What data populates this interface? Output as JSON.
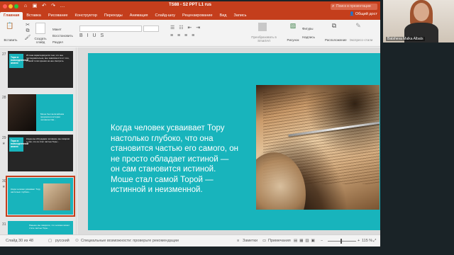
{
  "window": {
    "title": "TS88 - S2 PPT L1 rus",
    "search_placeholder": "Поиск в презентации",
    "share_label": "Общий дост"
  },
  "ribbon_tabs": [
    "Главная",
    "Вставка",
    "Рисование",
    "Конструктор",
    "Переходы",
    "Анимация",
    "Слайд-шоу",
    "Рецензирование",
    "Вид",
    "Запись"
  ],
  "ribbon": {
    "paste": "Вставить",
    "new_slide": "Создать слайд",
    "layout": "Макет",
    "reset": "Восстановить",
    "section": "Раздел",
    "convert_smartart": "Преобразовать в SmartArt",
    "picture": "Рисунок",
    "shapes": "Фигуры",
    "textbox": "Надпись",
    "arrange": "Расположение",
    "quick_styles": "Экспресс-стили"
  },
  "thumbnails": [
    {
      "num": "27",
      "text": "Истина характеризуется тем, что она последовательна, вне зависимости от того, с какой точки зрения на нее смотреть.",
      "title": "Тора в повседневной жизни",
      "variant": "dark"
    },
    {
      "num": "28",
      "text": "Моше был величайшим пророком в истории человечества...",
      "title": "",
      "variant": "photo"
    },
    {
      "num": "29",
      "text": "Когда мы обсуждаем человека, мы говорим о том, что он стал частью Торы...",
      "title": "Тора в повседневной жизни",
      "variant": "text"
    },
    {
      "num": "30",
      "text": "Когда человек усваивает Тору настолько глубоко...",
      "title": "",
      "variant": "paper",
      "selected": true
    },
    {
      "num": "31",
      "text": "Раньше мы говорили, что человек может стать частью Торы...",
      "title": "",
      "variant": "text"
    }
  ],
  "slide": {
    "body": "Когда человек усваивает Тору настолько глубоко, что она становится частью его самого, он не просто обладает истиной — он сам становится истиной. Моше стал самой Торой — истинной и неизменной."
  },
  "status": {
    "slide_counter": "Слайд 30 из 48",
    "language": "русский",
    "accessibility": "Специальные возможности: проверьте рекомендации",
    "notes": "Заметки",
    "comments": "Примечания",
    "zoom": "115 %"
  },
  "participant": {
    "name": "Batsheva Malka Albats"
  },
  "colors": {
    "ppt_accent": "#c43e1c",
    "slide_background": "#18b4bc"
  }
}
